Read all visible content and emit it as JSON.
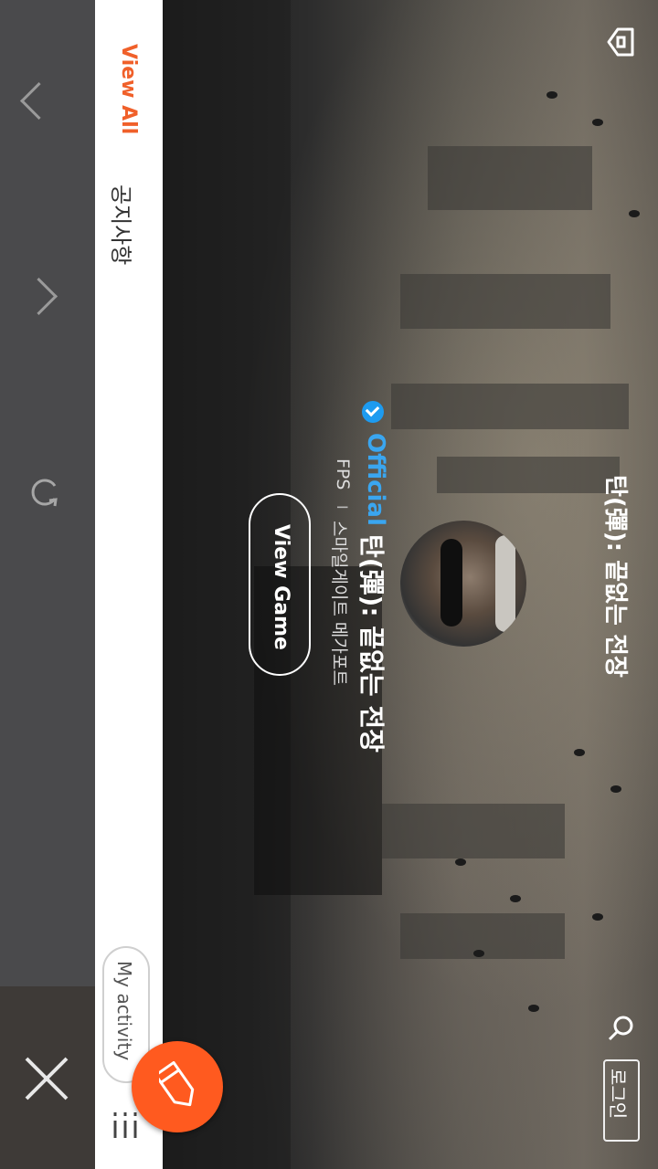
{
  "header": {
    "game_title": "탄(彈): 끝없는 전장",
    "login_label": "로그인"
  },
  "notice": {
    "title": "공지사항",
    "view_all": "View All"
  },
  "game": {
    "official_label": "Official",
    "name": "탄(彈): 끝없는 전장",
    "genre": "FPS",
    "separator": "I",
    "publisher": "스마일게이트 메가포트",
    "view_game_label": "View Game"
  },
  "activity": {
    "label": "My activity"
  },
  "icons": {
    "home": "home-icon",
    "search": "search-icon",
    "refresh": "refresh-icon",
    "close": "close-icon",
    "up": "chevron-up-icon",
    "down": "chevron-down-icon",
    "write": "pencil-icon",
    "menu": "menu-list-icon"
  },
  "colors": {
    "accent": "#f0602a",
    "official": "#3aa6f0",
    "fab": "#ff5a1f"
  }
}
